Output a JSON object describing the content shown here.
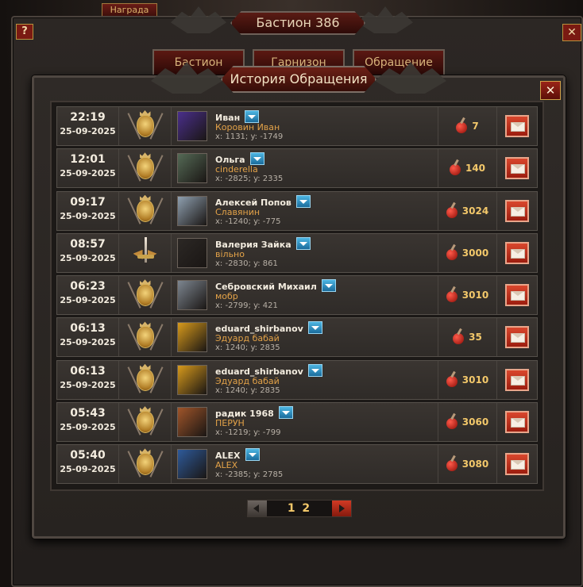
{
  "background_window": {
    "reward_tab": "Награда",
    "title": "Бастион 386",
    "help": "?",
    "close": "✕",
    "tabs": [
      "Бастион",
      "Гарнизон",
      "Обращение"
    ]
  },
  "dialog": {
    "title": "История Обращения",
    "close": "✕"
  },
  "rows": [
    {
      "time": "22:19",
      "date": "25-09-2025",
      "crest": "lion-shield-icon",
      "name": "Иван",
      "alliance": "Коровин Иван",
      "coords": "x: 1131; y: -1749",
      "avatar_color": "#4a2f8c",
      "resource": "7"
    },
    {
      "time": "12:01",
      "date": "25-09-2025",
      "crest": "lion-shield-icon",
      "name": "Ольга",
      "alliance": "cinderella",
      "coords": "x: -2825; y: 2335",
      "avatar_color": "#556a56",
      "resource": "140"
    },
    {
      "time": "09:17",
      "date": "25-09-2025",
      "crest": "lion-shield-icon",
      "name": "Алексей Попов",
      "alliance": "Славянин",
      "coords": "x: -1240; y: -775",
      "avatar_color": "#8fa0b0",
      "resource": "3024"
    },
    {
      "time": "08:57",
      "date": "25-09-2025",
      "crest": "winged-sword-icon",
      "name": "Валерия Зайка",
      "alliance": "вільно",
      "coords": "x: -2830; y: 861",
      "avatar_color": "#2c2825",
      "resource": "3000"
    },
    {
      "time": "06:23",
      "date": "25-09-2025",
      "crest": "lion-shield-icon",
      "name": "Себровский Михаил",
      "alliance": "мобр",
      "coords": "x: -2799; y: 421",
      "avatar_color": "#7d8690",
      "resource": "3010"
    },
    {
      "time": "06:13",
      "date": "25-09-2025",
      "crest": "lion-shield-icon",
      "name": "eduard_shirbanov",
      "alliance": "Эдуард бабай",
      "coords": "x: 1240; y: 2835",
      "avatar_color": "#d79a1c",
      "resource": "35"
    },
    {
      "time": "06:13",
      "date": "25-09-2025",
      "crest": "lion-shield-icon",
      "name": "eduard_shirbanov",
      "alliance": "Эдуард бабай",
      "coords": "x: 1240; y: 2835",
      "avatar_color": "#d79a1c",
      "resource": "3010"
    },
    {
      "time": "05:43",
      "date": "25-09-2025",
      "crest": "lion-shield-icon",
      "name": "радик 1968",
      "alliance": "ПЕРУН",
      "coords": "x: -1219; y: -799",
      "avatar_color": "#a0552a",
      "resource": "3060"
    },
    {
      "time": "05:40",
      "date": "25-09-2025",
      "crest": "lion-shield-icon",
      "name": "ALEX",
      "alliance": "ALEX",
      "coords": "x: -2385; y: 2785",
      "avatar_color": "#2e5a9a",
      "resource": "3080"
    }
  ],
  "pagination": {
    "pages": "1 2"
  },
  "colors": {
    "accent_gold": "#f3c86a",
    "alliance_orange": "#e3a248",
    "close_red": "#9a2418",
    "dropdown_blue": "#1a6c9c"
  }
}
